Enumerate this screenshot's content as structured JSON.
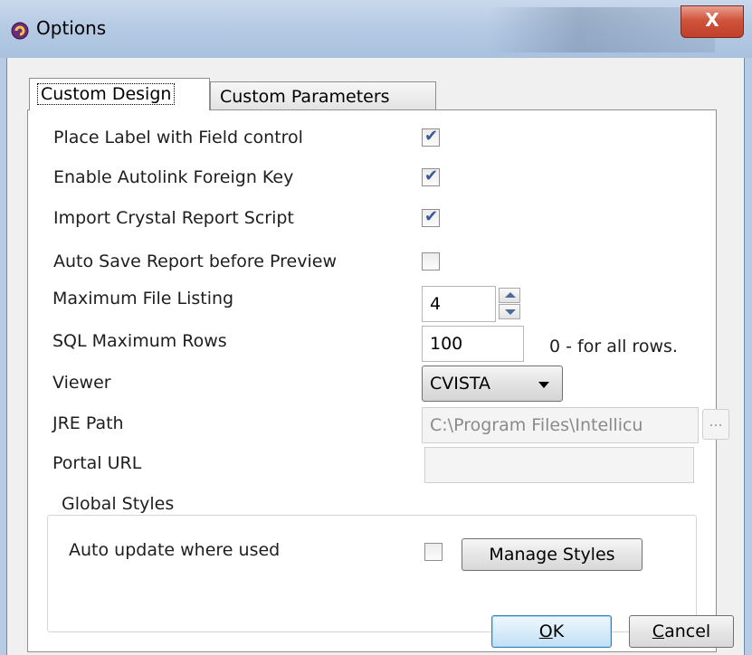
{
  "window": {
    "title": "Options",
    "close_label": "X"
  },
  "tabs": [
    {
      "label": "Custom Design",
      "active": true
    },
    {
      "label": "Custom Parameters",
      "active": false
    }
  ],
  "options": {
    "place_label": {
      "label": "Place Label with Field control",
      "checked": true
    },
    "autolink": {
      "label": "Enable Autolink Foreign Key",
      "checked": true
    },
    "crystal": {
      "label": "Import Crystal Report Script",
      "checked": true
    },
    "autosave": {
      "label": "Auto Save Report before Preview",
      "checked": false
    }
  },
  "max_file_listing": {
    "label": "Maximum File Listing",
    "value": "4"
  },
  "sql_max_rows": {
    "label": "SQL Maximum Rows",
    "value": "100",
    "hint": "0 - for all rows."
  },
  "viewer": {
    "label": "Viewer",
    "selected": "CVISTA"
  },
  "jre_path": {
    "label": "JRE Path",
    "value": "C:\\Program Files\\Intellicu",
    "browse_label": "..."
  },
  "portal_url": {
    "label": "Portal URL",
    "value": ""
  },
  "global_styles": {
    "legend": "Global Styles",
    "auto_update_label": "Auto update where used",
    "auto_update_checked": false,
    "manage_button": "Manage Styles"
  },
  "buttons": {
    "ok_mnemonic": "O",
    "ok_rest": "K",
    "cancel_mnemonic": "C",
    "cancel_rest": "ancel"
  },
  "colors": {
    "titlebar": "#b6cbe4",
    "close": "#d0533c",
    "check": "#3b5a9a",
    "default_button_border": "#3c7fb1"
  }
}
